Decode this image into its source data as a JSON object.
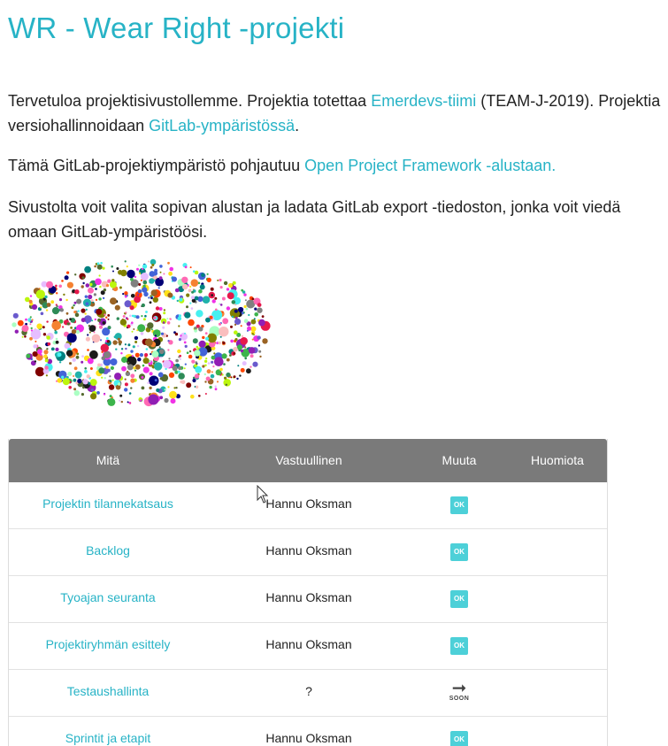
{
  "title": "WR - Wear Right -projekti",
  "intro": {
    "p1_a": "Tervetuloa projektisivustollemme. Projektia totettaa ",
    "p1_link1": "Emerdevs-tiimi",
    "p1_b": " (TEAM-J-2019). Projektia versiohallinnoidaan ",
    "p1_link2": "GitLab-ympäristössä",
    "p1_c": ".",
    "p2_a": "Tämä GitLab-projektiympäristö pohjautuu ",
    "p2_link": "Open Project Framework -alustaan.",
    "p3": "Sivustolta voit valita sopivan alustan ja ladata GitLab export -tiedoston, jonka voit viedä omaan GitLab-ympäristöösi."
  },
  "table": {
    "headers": [
      "Mitä",
      "Vastuullinen",
      "Muuta",
      "Huomiota"
    ],
    "rows": [
      {
        "what": "Projektin tilannekatsaus",
        "owner": "Hannu Oksman",
        "status": "OK"
      },
      {
        "what": "Backlog",
        "owner": "Hannu Oksman",
        "status": "OK"
      },
      {
        "what": "Tyoajan seuranta",
        "owner": "Hannu Oksman",
        "status": "OK"
      },
      {
        "what": "Projektiryhmän esittely",
        "owner": "Hannu Oksman",
        "status": "OK"
      },
      {
        "what": "Testaushallinta",
        "owner": "?",
        "status": "SOON"
      },
      {
        "what": "Sprintit ja etapit",
        "owner": "Hannu Oksman",
        "status": "OK"
      }
    ]
  },
  "colors": {
    "accent": "#27b3c6",
    "header_bg": "#7a7a7a",
    "ok_badge": "#4dd0d8"
  },
  "icons": {
    "soon": "right-arrow-icon",
    "brain": "colorful-dots-brain-image"
  }
}
